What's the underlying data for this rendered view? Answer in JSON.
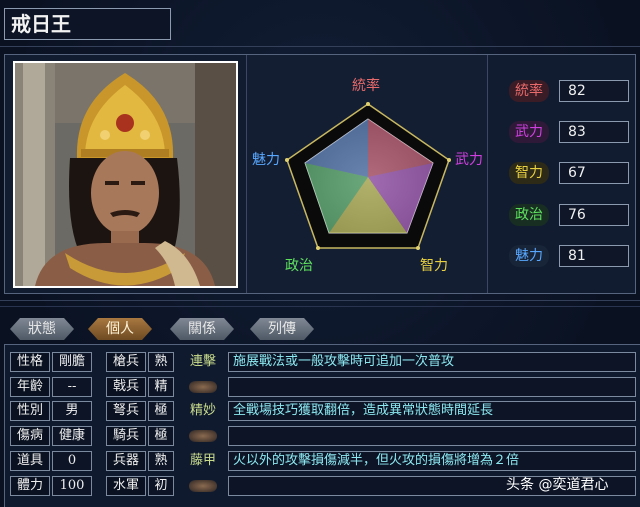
{
  "character": {
    "name": "戒日王"
  },
  "radar": {
    "labels": {
      "top": "統率",
      "right": "武力",
      "bottom_right": "智力",
      "bottom_left": "政治",
      "left": "魅力"
    },
    "label_colors": {
      "top": "#e86a6a",
      "right": "#d040e0",
      "bottom_right": "#e8d040",
      "bottom_left": "#5ee05e",
      "left": "#58a8ff"
    }
  },
  "stats": [
    {
      "label": "統率",
      "value": "82",
      "color": "#e86a6a",
      "bg": "#3a1c26"
    },
    {
      "label": "武力",
      "value": "83",
      "color": "#d040e0",
      "bg": "#2e1a38"
    },
    {
      "label": "智力",
      "value": "67",
      "color": "#e8d040",
      "bg": "#2e2a18"
    },
    {
      "label": "政治",
      "value": "76",
      "color": "#5ee05e",
      "bg": "#182e22"
    },
    {
      "label": "魅力",
      "value": "81",
      "color": "#58a8ff",
      "bg": "#182438"
    }
  ],
  "tabs": [
    {
      "label": "狀態",
      "active": false
    },
    {
      "label": "個人",
      "active": true
    },
    {
      "label": "關係",
      "active": false
    },
    {
      "label": "列傳",
      "active": false
    }
  ],
  "personal": [
    {
      "label": "性格",
      "value": "剛膽"
    },
    {
      "label": "年齡",
      "value": "--"
    },
    {
      "label": "性別",
      "value": "男"
    },
    {
      "label": "傷病",
      "value": "健康"
    },
    {
      "label": "道具",
      "value": "0"
    },
    {
      "label": "體力",
      "value": "100"
    }
  ],
  "troops": [
    {
      "label": "槍兵",
      "value": "熟"
    },
    {
      "label": "戟兵",
      "value": "精"
    },
    {
      "label": "弩兵",
      "value": "極"
    },
    {
      "label": "騎兵",
      "value": "極"
    },
    {
      "label": "兵器",
      "value": "熟"
    },
    {
      "label": "水軍",
      "value": "初"
    }
  ],
  "skills": [
    {
      "name": "連擊",
      "desc": "施展戰法或一般攻擊時可追加一次普攻"
    },
    {
      "name": "",
      "desc": ""
    },
    {
      "name": "精妙",
      "desc": "全戰場技巧獲取翻倍，造成異常狀態時間延長"
    },
    {
      "name": "",
      "desc": ""
    },
    {
      "name": "藤甲",
      "desc": "火以外的攻擊損傷減半，但火攻的損傷將增為２倍"
    },
    {
      "name": "",
      "desc": ""
    }
  ],
  "watermark": "头条 @奕道君心"
}
